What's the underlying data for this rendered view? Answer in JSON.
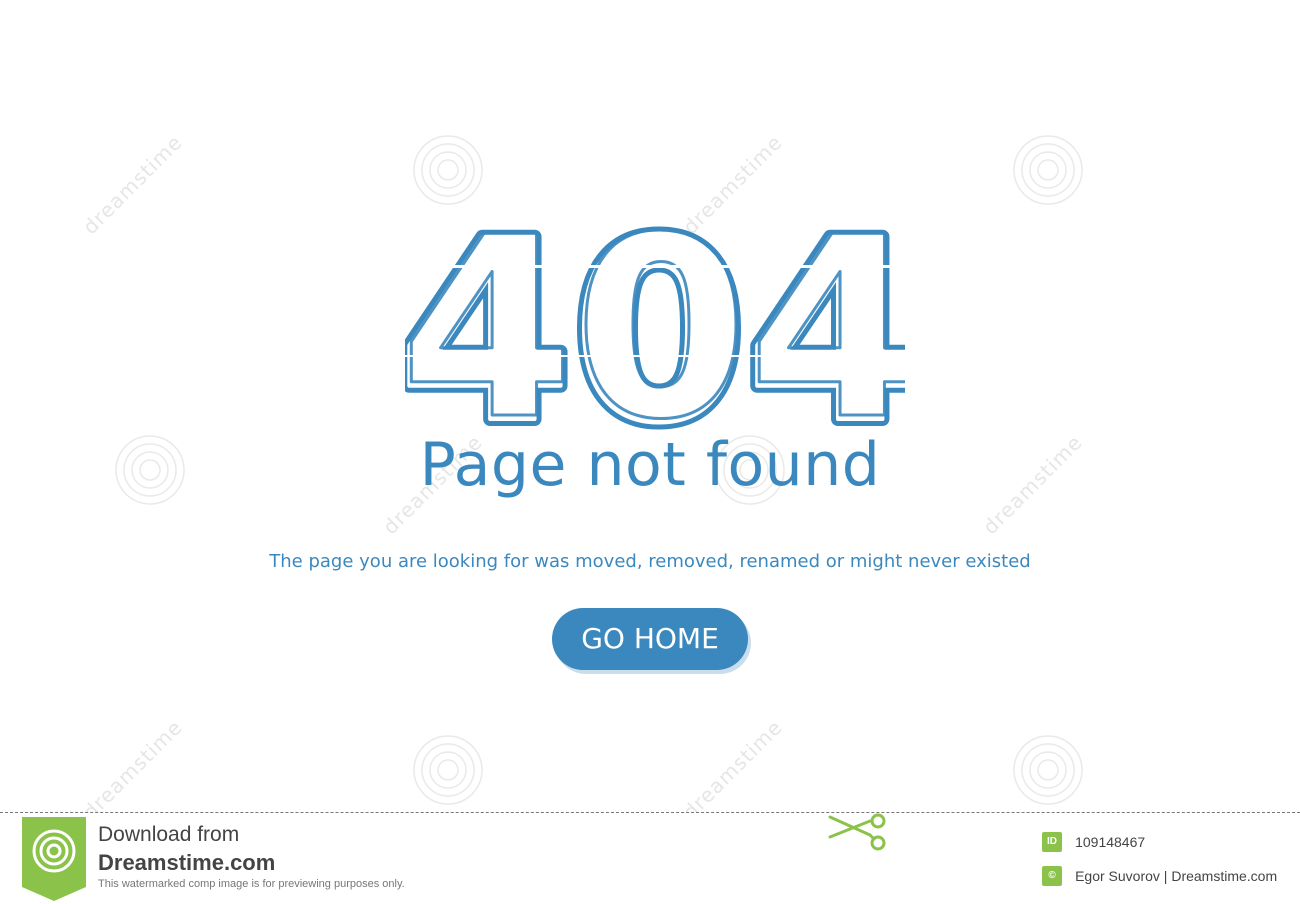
{
  "error": {
    "code": "404",
    "title": "Page not found",
    "message": "The page you are looking for was moved, removed, renamed or might never existed",
    "button_label": "GO HOME"
  },
  "colors": {
    "accent": "#3b88be",
    "button_shadow": "#c9ddec",
    "footer_badge": "#8bc34a"
  },
  "watermark": {
    "brand_text": "dreamstime"
  },
  "footer": {
    "download_line": "Download from",
    "site_name": "Dreamstime.com",
    "disclaimer": "This watermarked comp image is for previewing purposes only.",
    "id_badge": "ID",
    "image_id": "109148467",
    "author_credit": "Egor Suvorov | Dreamstime.com"
  }
}
